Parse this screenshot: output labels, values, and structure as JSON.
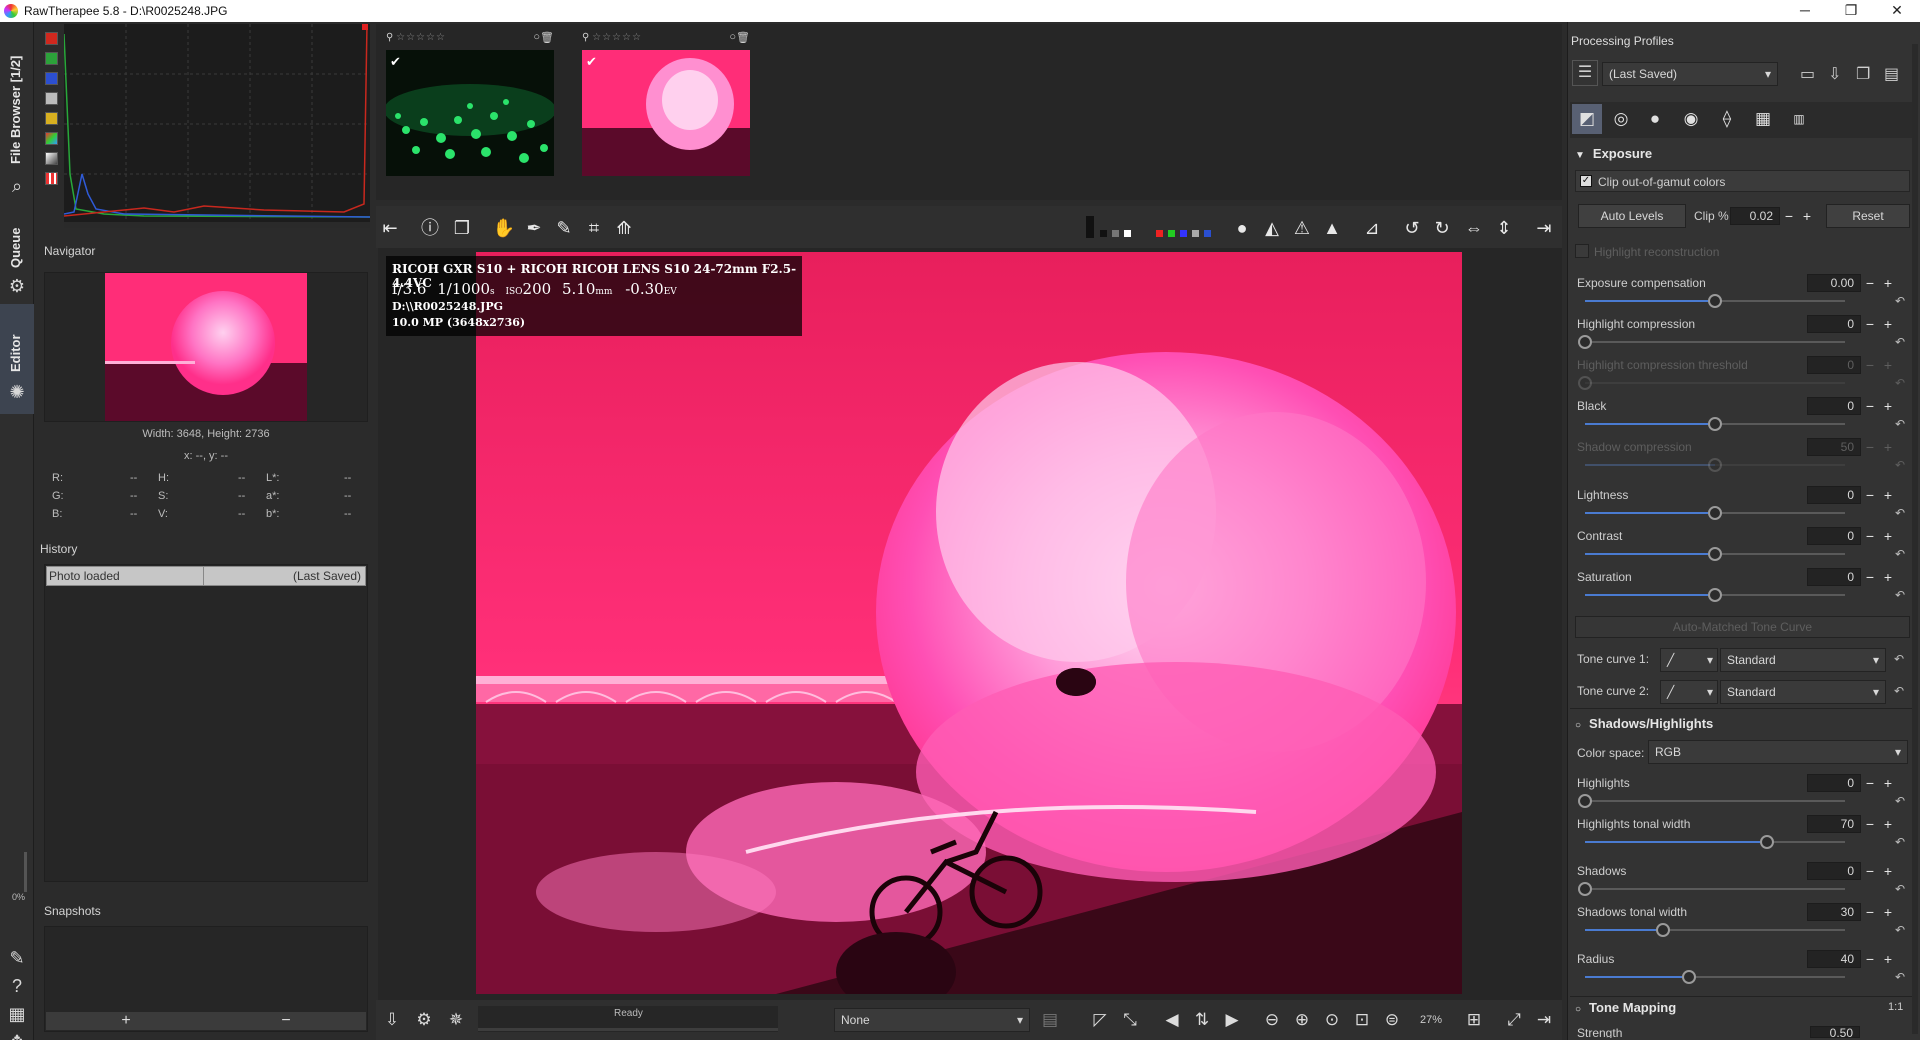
{
  "window": {
    "title": "RawTherapee 5.8 - D:\\R0025248.JPG",
    "minimize": "─",
    "maximize": "❐",
    "close": "✕"
  },
  "left_tabs": {
    "file_browser": "File Browser [1/2]",
    "queue": "Queue",
    "editor": "Editor",
    "progress": "0%"
  },
  "navigator": {
    "title": "Navigator",
    "size_text": "Width: 3648, Height: 2736",
    "coords_text": "x: --, y: --",
    "readouts": [
      {
        "label": "R:",
        "value": "--"
      },
      {
        "label": "H:",
        "value": "--"
      },
      {
        "label": "L*:",
        "value": "--"
      },
      {
        "label": "G:",
        "value": "--"
      },
      {
        "label": "S:",
        "value": "--"
      },
      {
        "label": "a*:",
        "value": "--"
      },
      {
        "label": "B:",
        "value": "--"
      },
      {
        "label": "V:",
        "value": "--"
      },
      {
        "label": "b*:",
        "value": "--"
      }
    ]
  },
  "history": {
    "title": "History",
    "entry_label": "Photo loaded",
    "entry_value": "(Last Saved)"
  },
  "snapshots": {
    "title": "Snapshots",
    "add": "+",
    "remove": "−"
  },
  "overlay": {
    "line1": "RICOH GXR S10 + RICOH RICOH LENS S10 24-72mm F2.5-4.4VC",
    "fnum": "f/3.6",
    "shutter": "1/1000",
    "shutter_unit": "s",
    "iso_label": "ISO",
    "iso": "200",
    "focal": "5.10",
    "focal_unit": "mm",
    "ev": "-0.30",
    "ev_unit": "EV",
    "path": "D:\\\\R0025248.JPG",
    "mp": "10.0 MP (3648x2736)"
  },
  "bottom_bar": {
    "status": "Ready",
    "preset_combo": "None",
    "zoom": "27%"
  },
  "right_panel": {
    "profiles_title": "Processing Profiles",
    "profile_value": "(Last Saved)",
    "exposure": {
      "title": "Exposure",
      "clip_label": "Clip out-of-gamut colors",
      "auto_levels": "Auto Levels",
      "clip_pct_label": "Clip %",
      "clip_pct_value": "0.02",
      "reset": "Reset",
      "highlight_recon": "Highlight reconstruction",
      "sliders": [
        {
          "label": "Exposure compensation",
          "value": "0.00",
          "level": 0.5
        },
        {
          "label": "Highlight compression",
          "value": "0",
          "level": 0.0
        },
        {
          "label": "Highlight compression threshold",
          "value": "0",
          "level": 0.0,
          "disabled": true
        },
        {
          "label": "Black",
          "value": "0",
          "level": 0.5
        },
        {
          "label": "Shadow compression",
          "value": "50",
          "level": 0.5,
          "disabled": true
        },
        {
          "label": "Lightness",
          "value": "0",
          "level": 0.5
        },
        {
          "label": "Contrast",
          "value": "0",
          "level": 0.5
        },
        {
          "label": "Saturation",
          "value": "0",
          "level": 0.5
        }
      ],
      "auto_matched": "Auto-Matched Tone Curve",
      "tone_curve_1_label": "Tone curve 1:",
      "tone_curve_1_value": "Standard",
      "tone_curve_2_label": "Tone curve 2:",
      "tone_curve_2_value": "Standard"
    },
    "shadows_highlights": {
      "title": "Shadows/Highlights",
      "color_space_label": "Color space:",
      "color_space_value": "RGB",
      "sliders": [
        {
          "label": "Highlights",
          "value": "0",
          "level": 0.0
        },
        {
          "label": "Highlights tonal width",
          "value": "70",
          "level": 0.7
        },
        {
          "label": "Shadows",
          "value": "0",
          "level": 0.0
        },
        {
          "label": "Shadows tonal width",
          "value": "30",
          "level": 0.3
        },
        {
          "label": "Radius",
          "value": "40",
          "level": 0.4
        }
      ]
    },
    "tone_mapping": {
      "title": "Tone Mapping",
      "ratio": "1:1",
      "strength_label": "Strength",
      "strength_value": "0.50"
    }
  }
}
